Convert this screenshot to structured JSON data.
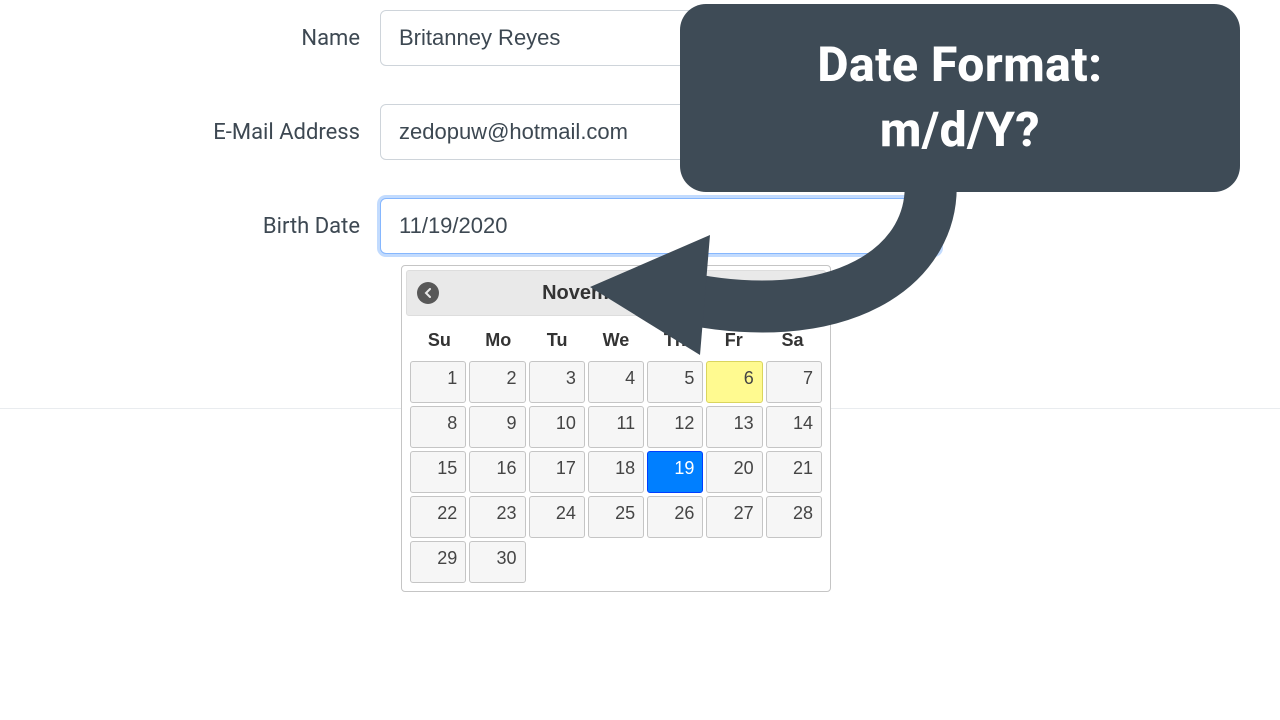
{
  "form": {
    "name": {
      "label": "Name",
      "value": "Britanney Reyes"
    },
    "email": {
      "label": "E-Mail Address",
      "value": "zedopuw@hotmail.com"
    },
    "birth_date": {
      "label": "Birth Date",
      "value": "11/19/2020"
    }
  },
  "datepicker": {
    "month_title": "November 2020",
    "weekdays": [
      "Su",
      "Mo",
      "Tu",
      "We",
      "Th",
      "Fr",
      "Sa"
    ],
    "days": [
      1,
      2,
      3,
      4,
      5,
      6,
      7,
      8,
      9,
      10,
      11,
      12,
      13,
      14,
      15,
      16,
      17,
      18,
      19,
      20,
      21,
      22,
      23,
      24,
      25,
      26,
      27,
      28,
      29,
      30
    ],
    "today": 6,
    "selected": 19
  },
  "callout": {
    "line1": "Date Format:",
    "line2": "m/d/Y?"
  },
  "colors": {
    "callout_bg": "#3e4b56",
    "selected_bg": "#007fff",
    "today_bg": "#fffa90"
  }
}
